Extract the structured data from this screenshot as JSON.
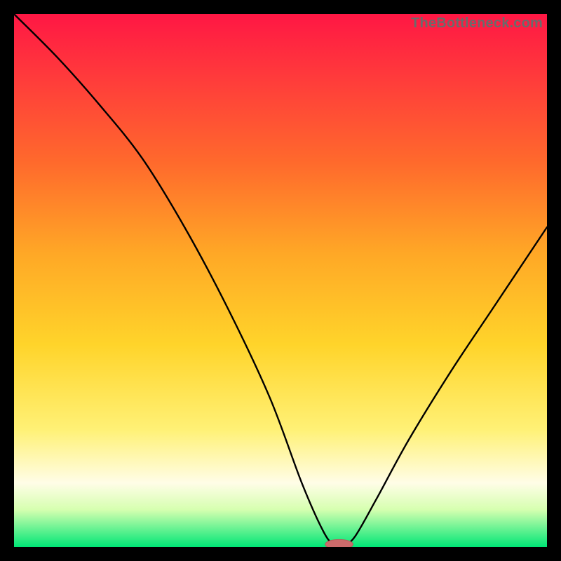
{
  "watermark": "TheBottleneck.com",
  "colors": {
    "frame": "#000000",
    "gradient_top": "#ff1744",
    "gradient_bottom": "#00e676",
    "curve": "#000000",
    "marker_fill": "#cc6b6b",
    "marker_stroke": "#b85a5a"
  },
  "chart_data": {
    "type": "line",
    "title": "",
    "xlabel": "",
    "ylabel": "",
    "xlim": [
      0,
      100
    ],
    "ylim": [
      0,
      100
    ],
    "grid": false,
    "legend": false,
    "series": [
      {
        "name": "bottleneck-curve",
        "x": [
          0,
          8,
          16,
          24,
          32,
          40,
          48,
          54,
          58,
          60,
          62,
          64,
          68,
          74,
          82,
          90,
          100
        ],
        "values": [
          100,
          92,
          83,
          73,
          60,
          45,
          28,
          12,
          3,
          0.5,
          0.5,
          2,
          9,
          20,
          33,
          45,
          60
        ]
      }
    ],
    "marker": {
      "x": 61,
      "y": 0.5,
      "rx": 2.6,
      "ry": 0.9
    },
    "notes": "x is relative horizontal position (0 = left edge of plot, 100 = right). values are percent of plot height from bottom (0 = bottom, 100 = top). Curve is a smooth V shape with minimum near x≈60–62."
  }
}
